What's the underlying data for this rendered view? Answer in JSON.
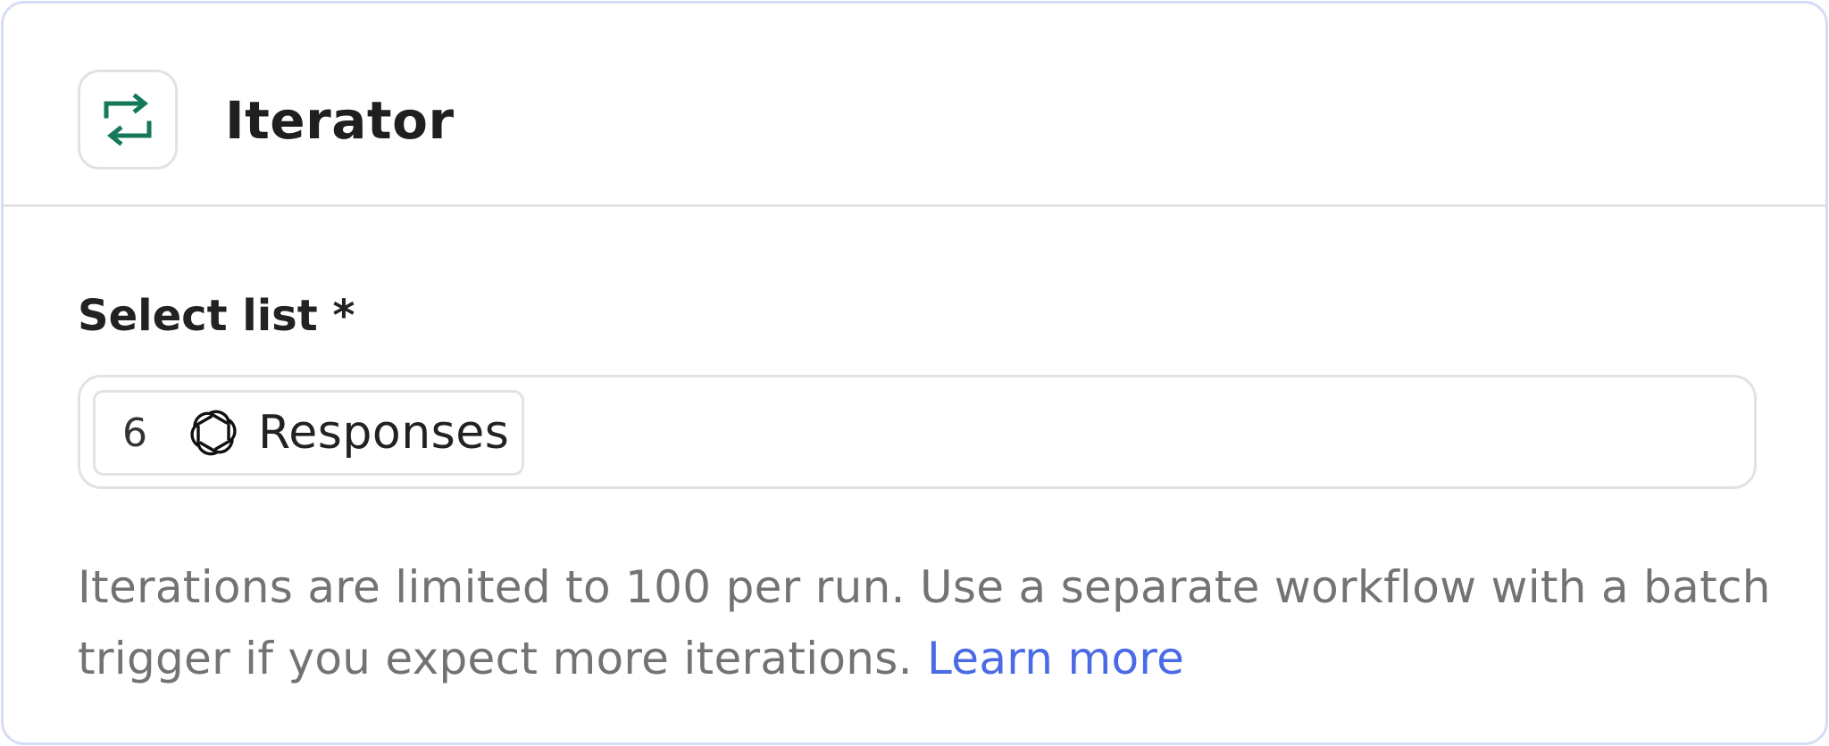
{
  "header": {
    "icon": "repeat-arrows-icon",
    "icon_color": "#16785a",
    "title": "Iterator"
  },
  "field": {
    "label": "Select list *",
    "selected": {
      "index": "6",
      "logo": "openai-logo-icon",
      "label": "Responses"
    }
  },
  "help": {
    "text": "Iterations are limited to 100 per run. Use a separate workflow with a batch trigger if you expect more iterations. ",
    "link_label": "Learn more",
    "link_color": "#4a6ae6"
  },
  "colors": {
    "card_border": "#d7dcf6",
    "divider": "#e4e4e4",
    "help_text": "#737373"
  }
}
